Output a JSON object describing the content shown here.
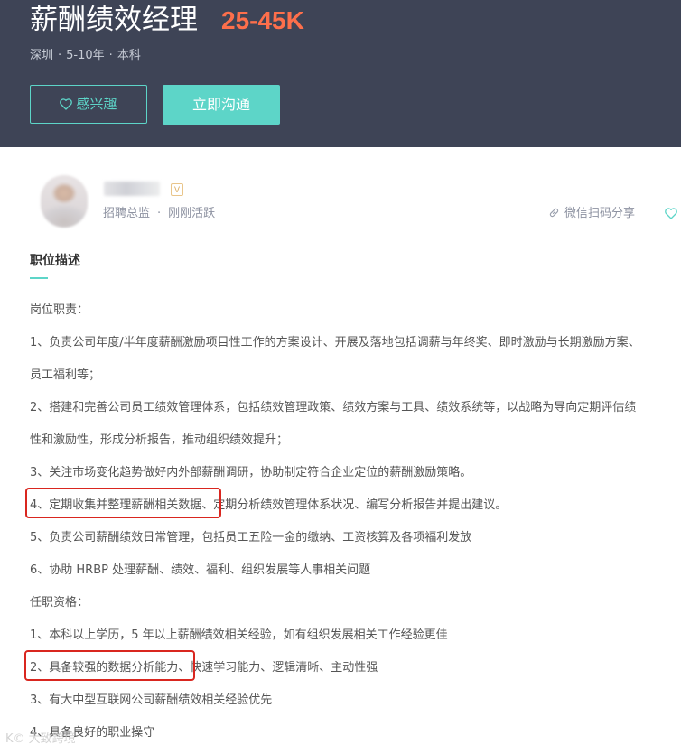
{
  "header": {
    "job_title": "薪酬绩效经理",
    "salary": "25-45K",
    "location": "深圳",
    "experience": "5-10年",
    "education": "本科",
    "dot": "·",
    "interest_button": "感兴趣",
    "chat_button": "立即沟通"
  },
  "recruiter": {
    "badge": "V",
    "title": "招聘总监",
    "sep": "·",
    "status": "刚刚活跃",
    "share_label": "微信扫码分享"
  },
  "description": {
    "section_title": "职位描述",
    "lines": [
      "岗位职责：",
      "1、负责公司年度/半年度薪酬激励项目性工作的方案设计、开展及落地包括调薪与年终奖、即时激励与长期激励方案、",
      "员工福利等；",
      "2、搭建和完善公司员工绩效管理体系，包括绩效管理政策、绩效方案与工具、绩效系统等，以战略为导向定期评估绩",
      "性和激励性，形成分析报告，推动组织绩效提升；",
      "3、关注市场变化趋势做好内外部薪酬调研，协助制定符合企业定位的薪酬激励策略。",
      "4、定期收集并整理薪酬相关数据、定期分析绩效管理体系状况、编写分析报告并提出建议。",
      "5、负责公司薪酬绩效日常管理，包括员工五险一金的缴纳、工资核算及各项福利发放",
      "6、协助 HRBP 处理薪酬、绩效、福利、组织发展等人事相关问题",
      "任职资格：",
      "1、本科以上学历，5 年以上薪酬绩效相关经验，如有组织发展相关工作经验更佳",
      "2、具备较强的数据分析能力、快速学习能力、逻辑清晰、主动性强",
      "3、有大中型互联网公司薪酬绩效相关经验优先",
      "4、具备良好的职业操守"
    ]
  },
  "watermark": "K© 大致跨境",
  "colors": {
    "header_bg": "#3e4456",
    "accent": "#5dd5c8",
    "salary": "#fd6f4b",
    "highlight": "#d9261f"
  }
}
